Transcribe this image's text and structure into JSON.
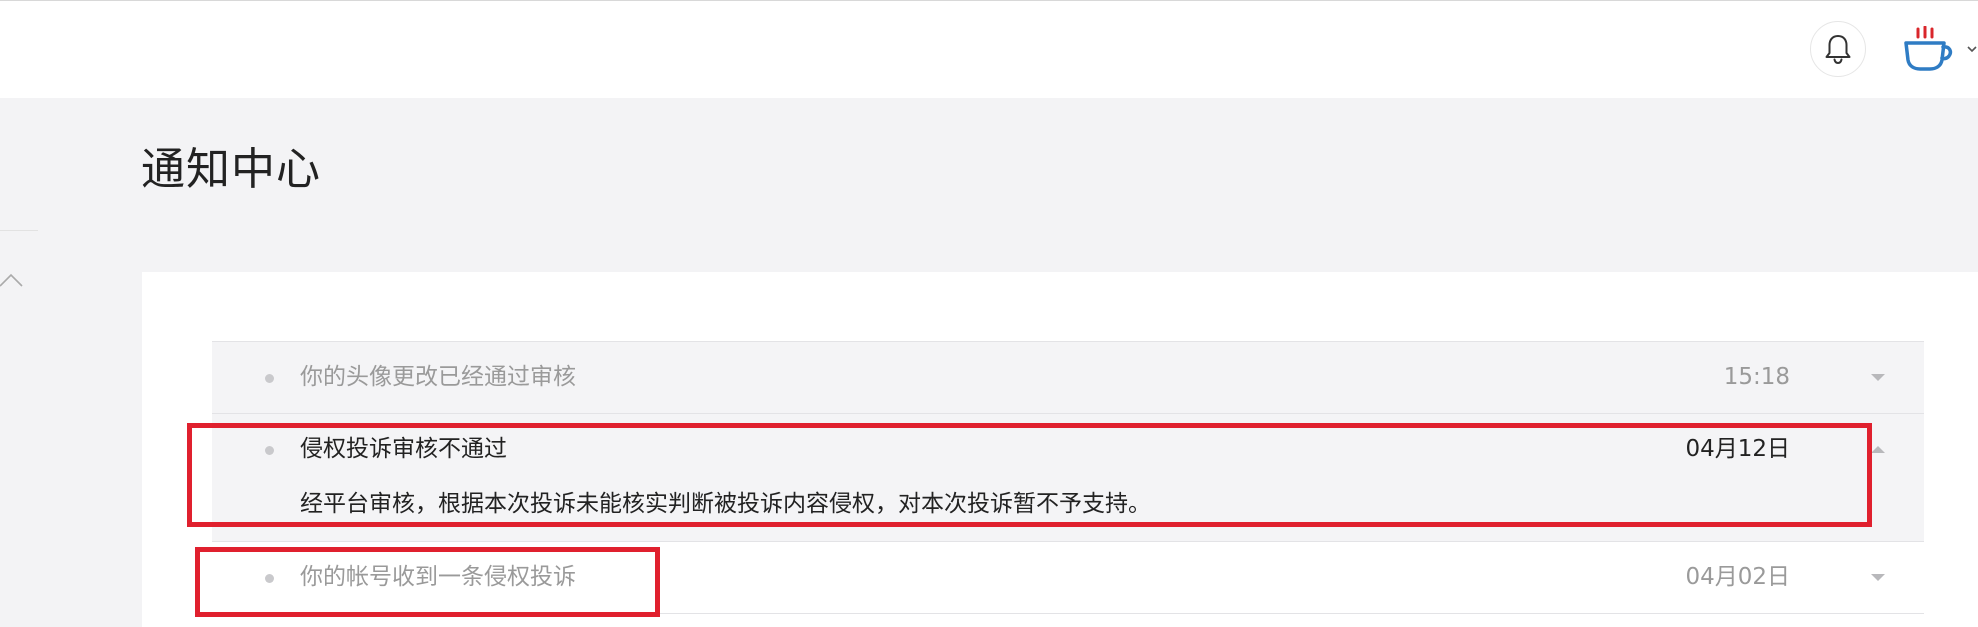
{
  "header": {
    "bell_icon": "bell-icon",
    "avatar_icon": "coffee-cup-icon",
    "caret_icon": "chevron-down-icon"
  },
  "page": {
    "title": "通知中心"
  },
  "notifications": [
    {
      "title": "你的头像更改已经通过审核",
      "time": "15:18",
      "read": true,
      "expanded": false
    },
    {
      "title": "侵权投诉审核不通过",
      "time": "04月12日",
      "body": "经平台审核，根据本次投诉未能核实判断被投诉内容侵权，对本次投诉暂不予支持。",
      "read": false,
      "expanded": true
    },
    {
      "title": "你的帐号收到一条侵权投诉",
      "time": "04月02日",
      "read": true,
      "expanded": false
    }
  ],
  "colors": {
    "highlight": "#e0202e",
    "avatar_blue": "#2f7cc4",
    "avatar_red": "#d9262b"
  }
}
